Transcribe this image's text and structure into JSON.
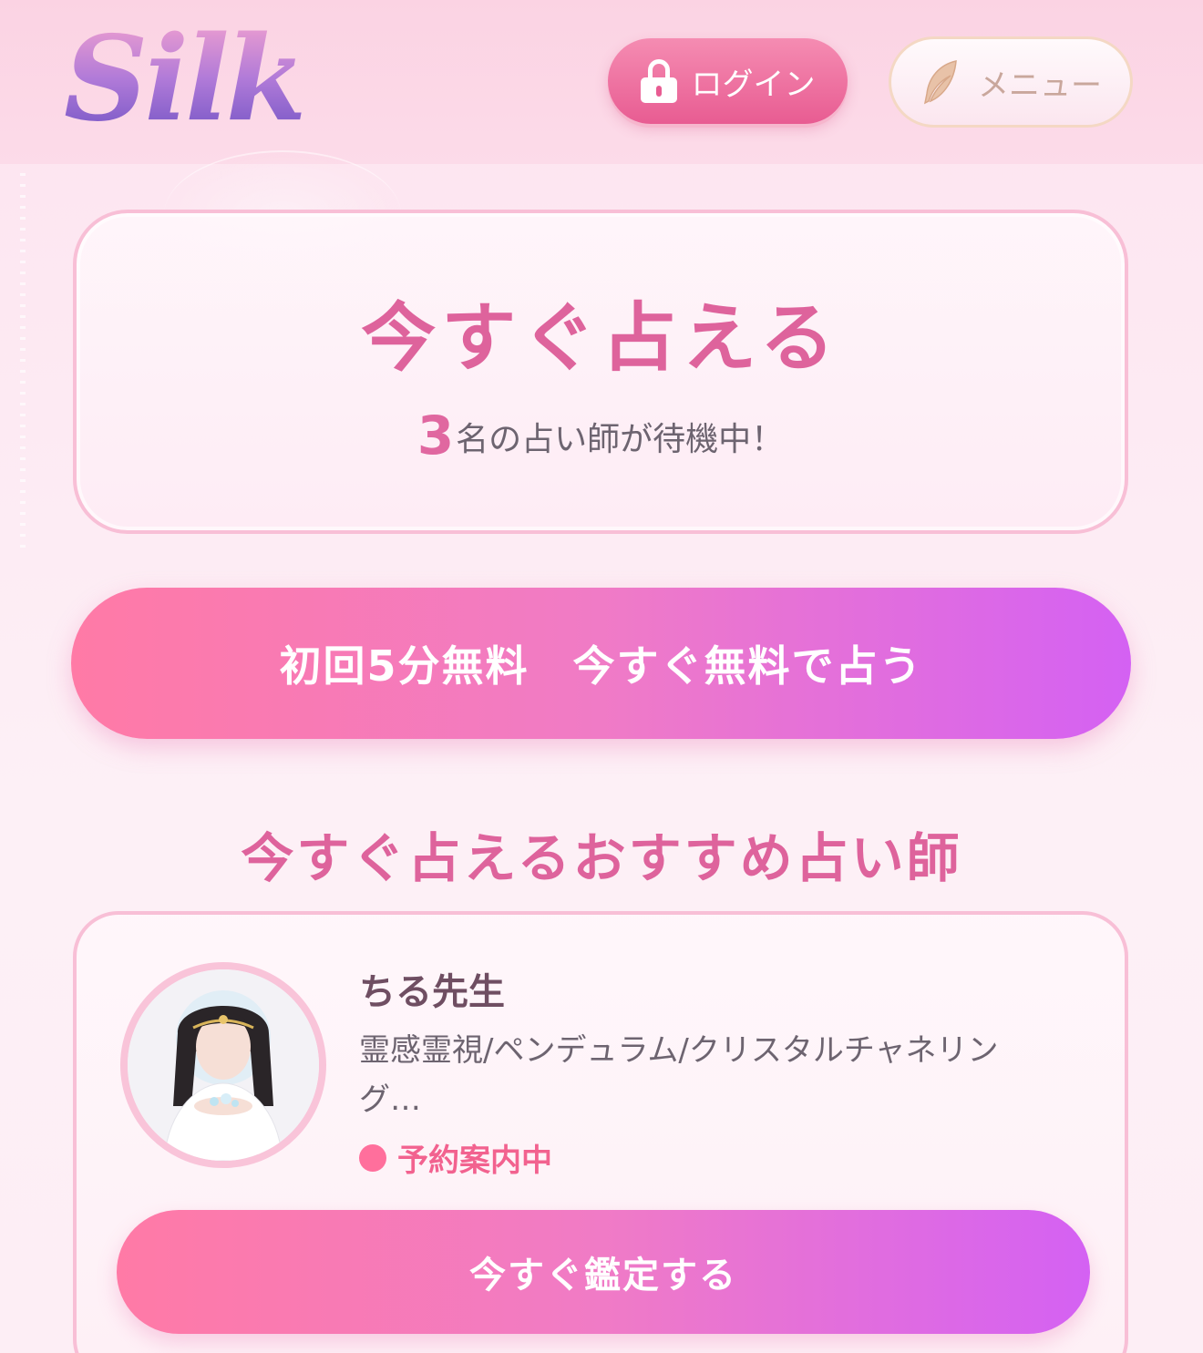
{
  "header": {
    "logo_text": "Silk",
    "login_label": "ログイン",
    "menu_label": "メニュー"
  },
  "status": {
    "title": "今すぐ占える",
    "count": "3",
    "count_suffix": "名の占い師が待機中！"
  },
  "cta": {
    "label": "初回5分無料　今すぐ無料で占う"
  },
  "recommend": {
    "heading": "今すぐ占えるおすすめ占い師",
    "advisor": {
      "name": "ちる先生",
      "tags": "霊感霊視/ペンデュラム/クリスタルチャネリング…",
      "status": "予約案内中",
      "button_label": "今すぐ鑑定する"
    }
  },
  "colors": {
    "accent_pink": "#de639c",
    "gradient_start": "#ff7aa6",
    "gradient_end": "#d461f3",
    "status_dot": "#ff6f9c"
  },
  "icons": {
    "login": "lock-icon",
    "menu": "feather-icon"
  }
}
